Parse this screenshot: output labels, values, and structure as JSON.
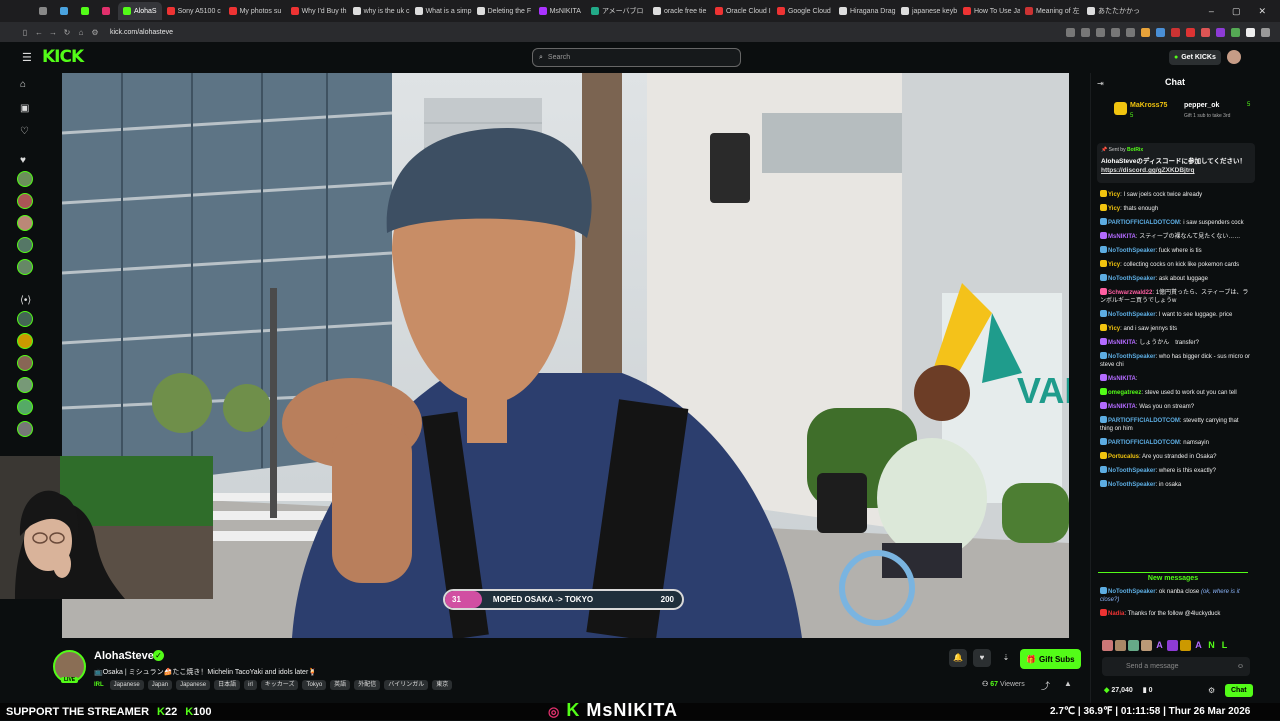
{
  "browser": {
    "tabs": [
      {
        "label": "",
        "color": "#888"
      },
      {
        "label": "",
        "color": "#4aa3df"
      },
      {
        "label": "",
        "color": "#53fc18"
      },
      {
        "label": "",
        "color": "#e1306c"
      },
      {
        "label": "AlohaS",
        "color": "#53fc18",
        "active": true
      },
      {
        "label": "Sony A5100 c",
        "color": "#e33"
      },
      {
        "label": "My photos su",
        "color": "#e33"
      },
      {
        "label": "Why I'd Buy th",
        "color": "#e33"
      },
      {
        "label": "why is the uk c",
        "color": "#ddd"
      },
      {
        "label": "What is a simp",
        "color": "#ddd"
      },
      {
        "label": "Deleting the F",
        "color": "#ddd"
      },
      {
        "label": "MsNIKITA",
        "color": "#a3f"
      },
      {
        "label": "アメーバブロ",
        "color": "#2a8"
      },
      {
        "label": "oracle free tie",
        "color": "#ddd"
      },
      {
        "label": "Oracle Cloud I",
        "color": "#e33"
      },
      {
        "label": "Google Cloud",
        "color": "#e33"
      },
      {
        "label": "Hiragana Drag",
        "color": "#ddd"
      },
      {
        "label": "japanese keyb",
        "color": "#ddd"
      },
      {
        "label": "How To Use Ja",
        "color": "#e33"
      },
      {
        "label": "Meaning of 左",
        "color": "#c33"
      },
      {
        "label": "あたたかかっ",
        "color": "#ddd"
      }
    ],
    "url": "kick.com/alohasteve"
  },
  "kick": {
    "logo": "KICK",
    "search_placeholder": "Search",
    "get_kicks": "Get KICKs"
  },
  "video": {
    "progress_start": "31",
    "progress_label": "MOPED OSAKA -> TOKYO",
    "progress_end": "200",
    "progress_fraction": 0.155
  },
  "stream": {
    "channel": "AlohaSteve",
    "live": "LIVE",
    "title": "📺Osaka | ミシュラン🍰たこ焼き！Michelin TacoYaki and idols later🍹",
    "category": "IRL",
    "tags": [
      "Japanese",
      "Japan",
      "Japanese",
      "日本語",
      "irl",
      "キッカーズ",
      "Tokyo",
      "英語",
      "外配信",
      "バイリンガル",
      "東京"
    ],
    "gift_subs": "Gift Subs",
    "viewers_count": "67",
    "viewers_label": "Viewers"
  },
  "chat": {
    "title": "Chat",
    "gift_user1": "MaKross75",
    "gift_user1_count": "5",
    "gift_user2": "pepper_ok",
    "gift_user2_count": "5",
    "gift_note": "Gift 1 sub to take 3rd",
    "pinned_by": "BotRix",
    "pinned_from": "Sent by",
    "pinned_msg": "AlohaSteveのディスコードに参加してください！",
    "pinned_link": "https://discord.gg/gZXKDBjtrq",
    "messages": [
      {
        "user": "Yicy",
        "color": "#f1c40f",
        "text": "I saw joels cock twice already"
      },
      {
        "user": "Yicy",
        "color": "#f1c40f",
        "text": "thats enough"
      },
      {
        "user": "PARTIOFFICIALDOTCOM",
        "color": "#5dade2",
        "text": "i saw suspenders cock"
      },
      {
        "user": "MsNIKITA",
        "color": "#b36bff",
        "text": "スティーブの裸なんて見たくない……"
      },
      {
        "user": "NoToothSpeaker",
        "color": "#5dade2",
        "text": "fuck where is tis"
      },
      {
        "user": "Yicy",
        "color": "#f1c40f",
        "text": "collecting cocks on kick like pokemon cards"
      },
      {
        "user": "NoToothSpeaker",
        "color": "#5dade2",
        "text": "ask about luggage"
      },
      {
        "user": "Schwarzwald22",
        "color": "#ff5fa2",
        "text": "1億円貰ったら、スティーブは、ランボルギーニ買うでしょうw"
      },
      {
        "user": "NoToothSpeaker",
        "color": "#5dade2",
        "text": "I want to see luggage. price"
      },
      {
        "user": "Yicy",
        "color": "#f1c40f",
        "text": "and i saw jennys tits"
      },
      {
        "user": "MsNIKITA",
        "color": "#b36bff",
        "text": "しょうかん　transfer?"
      },
      {
        "user": "NoToothSpeaker",
        "color": "#5dade2",
        "text": "who has bigger dick - sus micro or steve chi"
      },
      {
        "user": "MsNIKITA",
        "color": "#b36bff",
        "text": ""
      },
      {
        "user": "omegatreez",
        "color": "#53fc18",
        "text": "steve used to work out you can tell"
      },
      {
        "user": "MsNIKITA",
        "color": "#b36bff",
        "text": "Was you    on stream?"
      },
      {
        "user": "PARTIOFFICIALDOTCOM",
        "color": "#5dade2",
        "text": "stevetty carrying that thing on him"
      },
      {
        "user": "PARTIOFFICIALDOTCOM",
        "color": "#5dade2",
        "text": "namsayin"
      },
      {
        "user": "Portucalus",
        "color": "#f1c40f",
        "text": "Are you stranded in Osaka?"
      },
      {
        "user": "NoToothSpeaker",
        "color": "#5dade2",
        "text": "where is this exactly?"
      },
      {
        "user": "NoToothSpeaker",
        "color": "#5dade2",
        "text": "in osaka"
      }
    ],
    "new_messages": "New messages",
    "messages_after": [
      {
        "user": "NoToothSpeaker",
        "color": "#5dade2",
        "text": "ok nanba close",
        "reply": "(ok, where is it close?)"
      },
      {
        "user": "Nadia",
        "color": "#e33",
        "text": "Thanks for the follow @4luckyduck"
      }
    ],
    "send_placeholder": "Send a message",
    "kicks_count": "27,040",
    "other_count": "0",
    "chat_button": "Chat"
  },
  "ticker": {
    "support": "SUPPORT THE STREAMER",
    "count_a": "22",
    "count_b": "100",
    "brand": "MsNIKITA",
    "system": "2.7℃ | 36.9℉ | 01:11:58 | Thur 26 Mar 2026"
  }
}
